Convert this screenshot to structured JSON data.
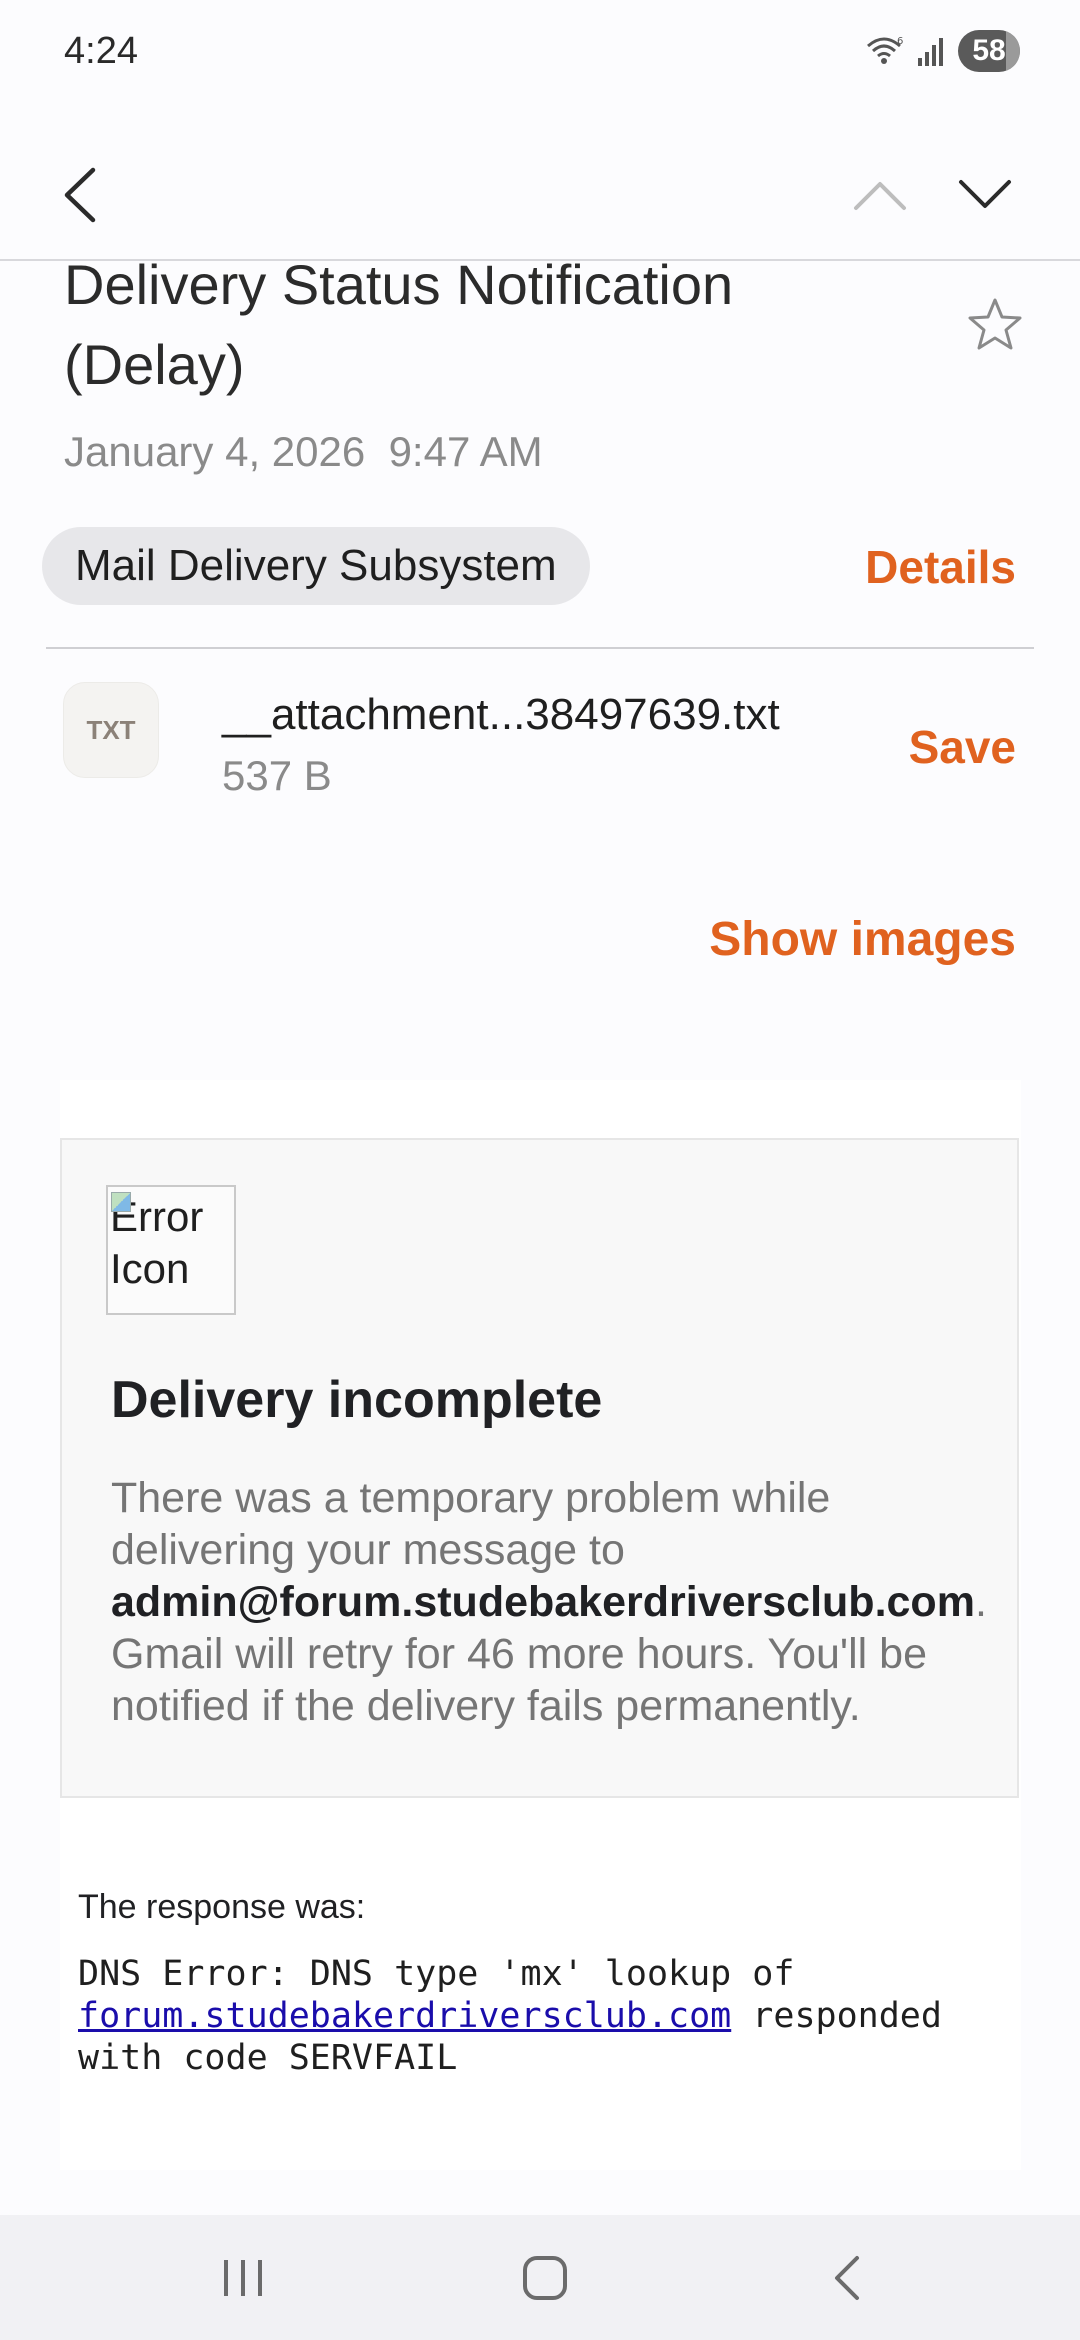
{
  "status_bar": {
    "time": "4:24",
    "battery": "58"
  },
  "email": {
    "subject": "Delivery Status Notification (Delay)",
    "date": "January 4, 2026",
    "time": "9:47 AM",
    "sender": "Mail Delivery Subsystem",
    "details_label": "Details",
    "attachment": {
      "type_label": "TXT",
      "name": "__attachment...38497639.txt",
      "size": "537 B",
      "save_label": "Save"
    },
    "show_images_label": "Show images"
  },
  "body": {
    "image_alt": "Error Icon",
    "title": "Delivery incomplete",
    "text_before": "There was a temporary problem while delivering your message to ",
    "recipient": "admin@forum.studebakerdriversclub.com",
    "text_after": ". Gmail will retry for 46 more hours. You'll be notified if the delivery fails permanently.",
    "response_label": "The response was:",
    "response_before": "DNS Error: DNS type 'mx' lookup of ",
    "response_link": "forum.studebakerdriversclub.com",
    "response_after": " responded with code SERVFAIL"
  },
  "colors": {
    "accent": "#e0621f",
    "link": "#1a0dab"
  },
  "icons": {
    "header": [
      "back-icon",
      "previous-icon",
      "next-icon",
      "star-icon"
    ],
    "status": [
      "wifi-icon",
      "signal-icon",
      "battery-icon"
    ],
    "nav": [
      "recents-icon",
      "home-icon",
      "nav-back-icon"
    ]
  }
}
